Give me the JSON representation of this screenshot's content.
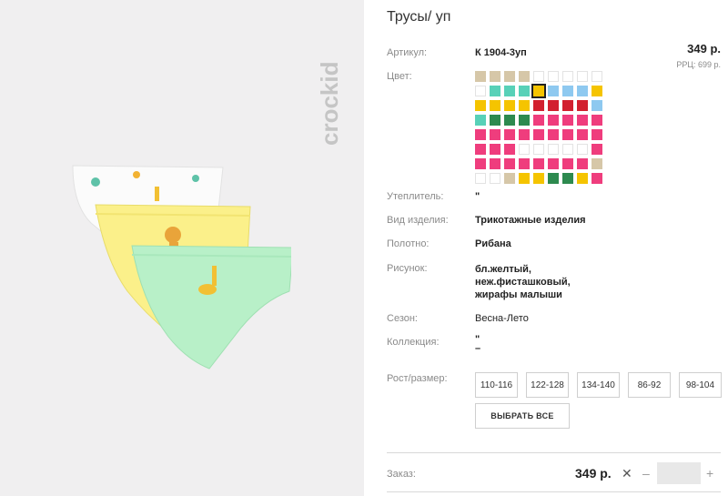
{
  "product": {
    "title": "Трусы/ уп",
    "brand": "crockid"
  },
  "price": {
    "value": "349 р.",
    "rrp": "РРЦ: 699 р."
  },
  "attributes": {
    "article_label": "Артикул:",
    "article_value": "К 1904-3уп",
    "color_label": "Цвет:",
    "insulation_label": "Утеплитель:",
    "insulation_value": "\"",
    "type_label": "Вид изделия:",
    "type_value": "Трикотажные изделия",
    "fabric_label": "Полотно:",
    "fabric_value": "Рибана",
    "pattern_label": "Рисунок:",
    "pattern_lines": [
      "бл.желтый,",
      "неж.фисташковый,",
      "жирафы малыши"
    ],
    "season_label": "Сезон:",
    "season_value": "Весна-Лето",
    "collection_label": "Коллекция:",
    "collection_value": "\"",
    "collection_value2": "–"
  },
  "size_selector": {
    "label": "Рост/размер:",
    "sizes": [
      "110-116",
      "122-128",
      "134-140",
      "86-92",
      "98-104"
    ],
    "select_all": "ВЫБРАТЬ ВСЕ"
  },
  "order": {
    "label": "Заказ:",
    "price": "349 р.",
    "remove_icon": "close-icon",
    "minus": "–",
    "plus": "+",
    "quantity": ""
  },
  "colors": {
    "beige": "#d6c7a8",
    "turquoise": "#58d1b8",
    "yellow": "#f5c400",
    "lightblue": "#8ec9f0",
    "red": "#d2202f",
    "pink": "#ef3d7d",
    "green": "#2d8a4f",
    "empty": "#ffffff"
  },
  "swatches": [
    [
      "beige",
      "beige",
      "beige",
      "beige",
      "empty",
      "empty",
      "empty",
      "empty",
      "empty"
    ],
    [
      "empty",
      "turquoise",
      "turquoise",
      "turquoise",
      "yellow",
      "lightblue",
      "lightblue",
      "lightblue",
      "yellow"
    ],
    [
      "yellow",
      "yellow",
      "yellow",
      "yellow",
      "red",
      "red",
      "red",
      "red",
      "lightblue"
    ],
    [
      "turquoise",
      "green",
      "green",
      "green",
      "pink",
      "pink",
      "pink",
      "pink",
      "pink"
    ],
    [
      "pink",
      "pink",
      "pink",
      "pink",
      "pink",
      "pink",
      "pink",
      "pink",
      "pink"
    ],
    [
      "pink",
      "pink",
      "pink",
      "empty",
      "empty",
      "empty",
      "empty",
      "empty",
      "pink"
    ],
    [
      "pink",
      "pink",
      "pink",
      "pink",
      "pink",
      "pink",
      "pink",
      "pink",
      "beige"
    ],
    [
      "empty",
      "empty",
      "beige",
      "yellow",
      "yellow",
      "green",
      "green",
      "yellow",
      "pink"
    ]
  ],
  "selected_swatch": "1-4"
}
